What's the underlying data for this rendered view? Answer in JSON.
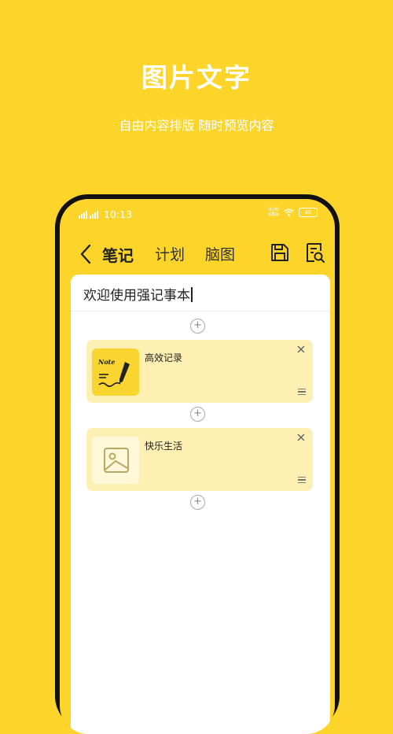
{
  "promo": {
    "headline": "图片文字",
    "subline": "自由内容排版 随时预览内容"
  },
  "status_bar": {
    "time": "10:13",
    "net_speed_top": "0.00",
    "net_speed_bottom": "KB/s",
    "battery": "30"
  },
  "toolbar": {
    "tabs": [
      {
        "label": "笔记",
        "active": true
      },
      {
        "label": "计划",
        "active": false
      },
      {
        "label": "脑图",
        "active": false
      }
    ],
    "icons": [
      "back-icon",
      "save-icon",
      "preview-icon"
    ]
  },
  "editor": {
    "title": "欢迎使用强记事本",
    "items": [
      {
        "label": "高效记录",
        "thumb": "note-pencil-icon",
        "thumb_text": "Note"
      },
      {
        "label": "快乐生活",
        "thumb": "image-placeholder-icon"
      }
    ]
  },
  "colors": {
    "background": "#FDD52A",
    "item_background": "#FEF0B3",
    "phone_frame": "#111111"
  }
}
